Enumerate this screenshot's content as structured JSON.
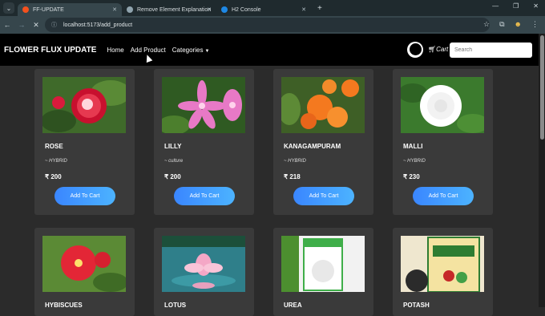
{
  "browser": {
    "tabs": [
      {
        "title": "FF-UPDATE",
        "fav_color": "#f4511e"
      },
      {
        "title": "Remove Element Explanation",
        "fav_color": "#90a4ae"
      },
      {
        "title": "H2 Console",
        "fav_color": "#1e88e5"
      }
    ],
    "url": "localhost:5173/add_product"
  },
  "navbar": {
    "brand": "FLOWER FLUX UPDATE",
    "links": [
      "Home",
      "Add Product",
      "Categories"
    ],
    "cart_label": "Cart",
    "search_placeholder": "Search"
  },
  "products": [
    {
      "name": "ROSE",
      "type": "~ HYBRID",
      "price": "₹ 200",
      "button": "Add To Cart",
      "image": "rose",
      "bg": "#4e7a2f",
      "accent": "#d81b3c"
    },
    {
      "name": "LILLY",
      "type": "~ culture",
      "price": "₹ 200",
      "button": "Add To Cart",
      "image": "lily",
      "bg": "#3d6b2a",
      "accent": "#e879c6"
    },
    {
      "name": "KANAGAMPURAM",
      "type": "~ HYBRID",
      "price": "₹ 218",
      "button": "Add To Cart",
      "image": "kanagampuram",
      "bg": "#4a6b2c",
      "accent": "#f4791f"
    },
    {
      "name": "MALLI",
      "type": "~ HYBRID",
      "price": "₹ 230",
      "button": "Add To Cart",
      "image": "malli",
      "bg": "#3f7a2d",
      "accent": "#ffffff"
    },
    {
      "name": "HYBISCUES",
      "image": "hibiscus",
      "bg": "#5b8a35",
      "accent": "#e32636"
    },
    {
      "name": "LOTUS",
      "image": "lotus",
      "bg": "#2f7f8a",
      "accent": "#f4a7c6"
    },
    {
      "name": "UREA",
      "image": "urea",
      "bg": "#f2f2f2",
      "accent": "#3fae49"
    },
    {
      "name": "POTASH",
      "image": "potash",
      "bg": "#efe7cf",
      "accent": "#2e7d32"
    }
  ]
}
